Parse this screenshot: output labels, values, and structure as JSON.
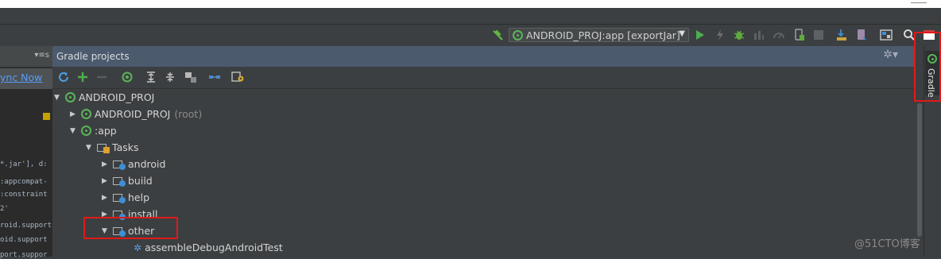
{
  "toolbar": {
    "run_config": "ANDROID_PROJ:app [exportJar]",
    "run_config_arrow": "▼"
  },
  "left_panel": {
    "header_glyph": "▾≡s",
    "sync_link": "ync Now",
    "code_lines": [
      "*.jar'], d:",
      ":appcompat-",
      ":constraint",
      "2'",
      "roid.support",
      "oid.support",
      "port.suppor"
    ]
  },
  "gradle_panel": {
    "title": "Gradle projects",
    "settings_glyph": "✲▾",
    "tree": [
      {
        "label": "ANDROID_PROJ",
        "suffix": "",
        "expand": "▼"
      },
      {
        "label": "ANDROID_PROJ",
        "suffix": "(root)",
        "expand": "▶"
      },
      {
        "label": ":app",
        "suffix": "",
        "expand": "▼"
      },
      {
        "label": "Tasks",
        "suffix": "",
        "expand": "▼"
      },
      {
        "label": "android",
        "suffix": "",
        "expand": "▶"
      },
      {
        "label": "build",
        "suffix": "",
        "expand": "▶"
      },
      {
        "label": "help",
        "suffix": "",
        "expand": "▶"
      },
      {
        "label": "install",
        "suffix": "",
        "expand": "▶"
      },
      {
        "label": "other",
        "suffix": "",
        "expand": "▼"
      },
      {
        "label": "assembleDebugAndroidTest",
        "suffix": "",
        "expand": ""
      }
    ]
  },
  "side_tab": {
    "label": "Gradle"
  },
  "watermark": "@51CTO博客",
  "colors": {
    "accent_green": "#5ab45a",
    "link_blue": "#589df6",
    "highlight_red": "#e0191a",
    "panel_header": "#4b5a6d"
  }
}
